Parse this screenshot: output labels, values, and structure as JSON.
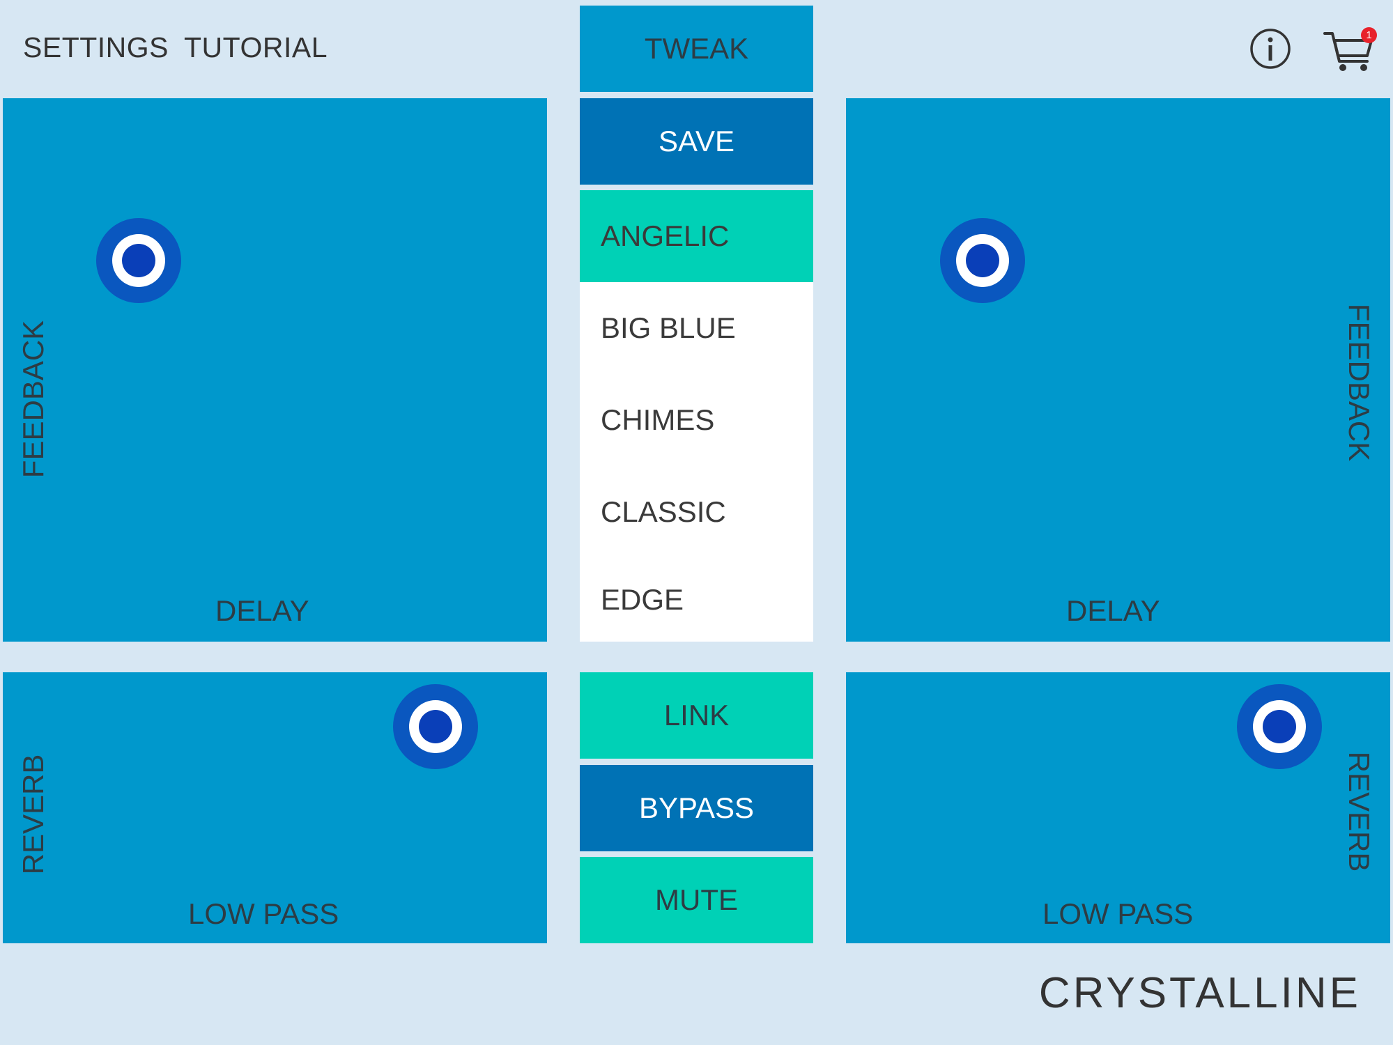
{
  "topbar": {
    "settings_label": "SETTINGS",
    "tutorial_label": "TUTORIAL",
    "cart_badge": "1"
  },
  "center": {
    "tweak_label": "TWEAK",
    "save_label": "SAVE",
    "presets": [
      {
        "label": "ANGELIC",
        "selected": true
      },
      {
        "label": "BIG BLUE",
        "selected": false
      },
      {
        "label": "CHIMES",
        "selected": false
      },
      {
        "label": "CLASSIC",
        "selected": false
      },
      {
        "label": "EDGE",
        "selected": false
      }
    ],
    "link_label": "LINK",
    "bypass_label": "BYPASS",
    "mute_label": "MUTE"
  },
  "left_top_pad": {
    "x_label": "DELAY",
    "y_label": "FEEDBACK"
  },
  "right_top_pad": {
    "x_label": "DELAY",
    "y_label": "FEEDBACK"
  },
  "left_bottom_pad": {
    "x_label": "LOW PASS",
    "y_label": "REVERB"
  },
  "right_bottom_pad": {
    "x_label": "LOW PASS",
    "y_label": "REVERB"
  },
  "brand": "CRYSTALLINE",
  "colors": {
    "background": "#d7e7f3",
    "pad": "#0098cc",
    "tweak": "#0098cc",
    "dark_button": "#0072b5",
    "teal_button": "#00d1b6",
    "knob": "#0a57bf",
    "badge": "#e8222b"
  }
}
